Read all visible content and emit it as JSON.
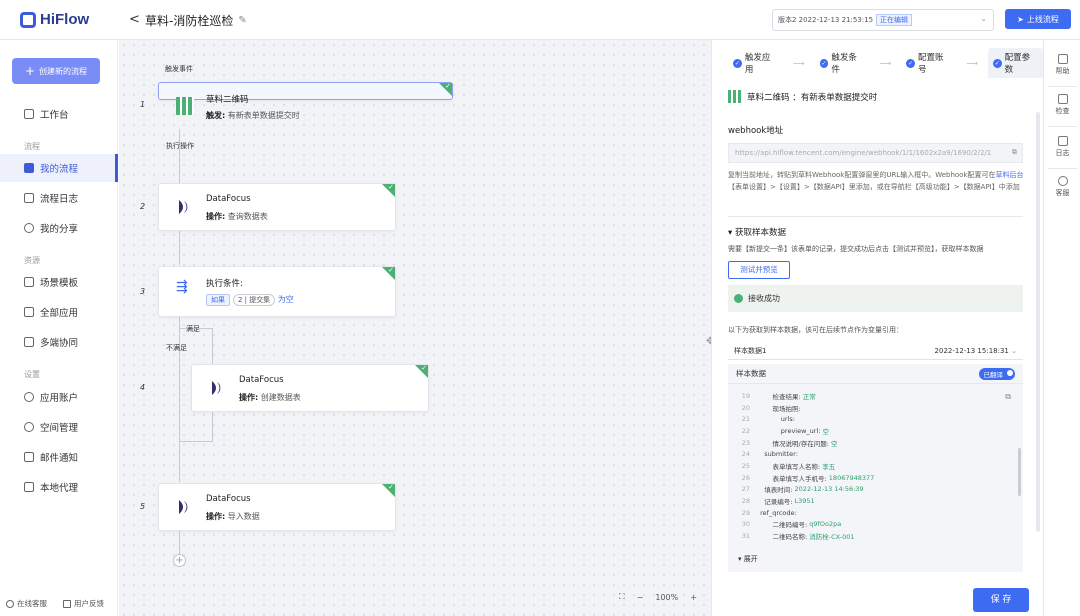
{
  "header": {
    "logo": "HiFlow",
    "back": "<",
    "title": "草料-消防栓巡检",
    "edit_icon": "pencil-icon",
    "version_text": "版本2 2022-12-13 21:53:15",
    "version_tag": "正在编辑",
    "publish_label": "上线流程"
  },
  "sidebar": {
    "new_label": "创建新的流程",
    "items": [
      {
        "label": "工作台"
      }
    ],
    "group1": "流程",
    "g1": [
      {
        "label": "我的流程"
      },
      {
        "label": "流程日志"
      },
      {
        "label": "我的分享"
      }
    ],
    "group2": "资源",
    "g2": [
      {
        "label": "场景模板"
      },
      {
        "label": "全部应用"
      },
      {
        "label": "多端协同"
      }
    ],
    "group3": "设置",
    "g3": [
      {
        "label": "应用账户"
      },
      {
        "label": "空间管理"
      },
      {
        "label": "邮件通知"
      },
      {
        "label": "本地代理"
      }
    ],
    "footer": [
      "在线客服",
      "用户反馈"
    ]
  },
  "canvas": {
    "trigger_label": "触发事件",
    "exec_label": "执行操作",
    "yes_label": "满足",
    "no_label": "不满足",
    "nodes": [
      {
        "num": "1",
        "title": "草料二维码",
        "prefix": "触发:",
        "desc": "有新表单数据提交时"
      },
      {
        "num": "2",
        "title": "DataFocus",
        "prefix": "操作:",
        "desc": "查询数据表"
      },
      {
        "num": "3",
        "title": "执行条件:",
        "pill": "如果",
        "pill2": "2 | 提交集",
        "tail": "为空"
      },
      {
        "num": "4",
        "title": "DataFocus",
        "prefix": "操作:",
        "desc": "创建数据表"
      },
      {
        "num": "5",
        "title": "DataFocus",
        "prefix": "操作:",
        "desc": "导入数据"
      }
    ],
    "zoom": "100%",
    "zoom_minus": "−",
    "zoom_plus": "+",
    "plus": "+"
  },
  "panel": {
    "steps": [
      "触发应用",
      "触发条件",
      "配置账号",
      "配置参数"
    ],
    "app_title": "草料二维码 ：有新表单数据提交时",
    "webhook_label": "webhook地址",
    "url": "https://api.hiflow.tencent.com/engine/webhook/1/1/1602x2a9/1690/2/2/1",
    "hint1": "复制当前地址，转贴到草料Webhook配置弹窗里的URL输入框中。Webhook配置可在",
    "hint_link": "草料后台",
    "hint2": "【表单设置】>【设置】>【数据API】里添加，或在导航栏【高级功能】>【数据API】中添加",
    "sample_title": "获取样本数据",
    "sample_desc": "需要【新提交一条】该表单的记录，提交成功后点击【测试并预览】，获取样本数据",
    "test_btn": "测试并预览",
    "ok_msg": "接收成功",
    "sample_lbl": "以下为获取到样本数据，该可在后续节点作为变量引用：",
    "select_name": "样本数据1",
    "select_time": "2022-12-13 15:18:31",
    "box_title": "样本数据",
    "toggle": "已翻译",
    "lines": [
      {
        "no": "19",
        "k": "        检查结果: ",
        "v": "正常"
      },
      {
        "no": "20",
        "k": "        现场拍照:",
        "v": ""
      },
      {
        "no": "21",
        "k": "            urls:",
        "v": ""
      },
      {
        "no": "22",
        "k": "            preview_url: ",
        "v": "空"
      },
      {
        "no": "23",
        "k": "        情况说明/存在问题: ",
        "v": "空"
      },
      {
        "no": "24",
        "k": "    submitter:",
        "v": ""
      },
      {
        "no": "25",
        "k": "        表单填写人名称: ",
        "v": "李五"
      },
      {
        "no": "26",
        "k": "        表单填写人手机号: ",
        "v": "18067948377"
      },
      {
        "no": "27",
        "k": "    填表时间: ",
        "v": "2022-12-13 14:56:39"
      },
      {
        "no": "28",
        "k": "    记录编号: ",
        "v": "L3951"
      },
      {
        "no": "29",
        "k": "  ref_qrcode:",
        "v": ""
      },
      {
        "no": "30",
        "k": "        二维码编号: ",
        "v": "q9fOo2pa"
      },
      {
        "no": "31",
        "k": "        二维码名称: ",
        "v": "消防栓-CX-001"
      }
    ],
    "expand": "展开",
    "save": "保 存"
  },
  "rightbar": [
    "帮助",
    "检查",
    "日志",
    "客服"
  ]
}
